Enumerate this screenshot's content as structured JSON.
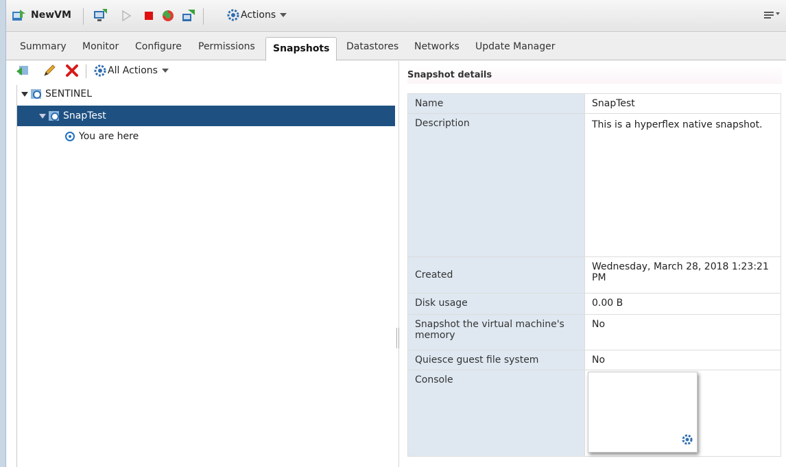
{
  "toolbar": {
    "vm_name": "NewVM",
    "actions_label": "Actions"
  },
  "tabs": [
    {
      "label": "Summary"
    },
    {
      "label": "Monitor"
    },
    {
      "label": "Configure"
    },
    {
      "label": "Permissions"
    },
    {
      "label": "Snapshots"
    },
    {
      "label": "Datastores"
    },
    {
      "label": "Networks"
    },
    {
      "label": "Update Manager"
    }
  ],
  "snapshot_toolbar": {
    "all_actions_label": "All Actions"
  },
  "tree": {
    "root": "SENTINEL",
    "snapshot": "SnapTest",
    "current": "You are here"
  },
  "details": {
    "header": "Snapshot details",
    "rows": [
      {
        "key": "Name",
        "value": "SnapTest"
      },
      {
        "key": "Description",
        "value": "This is a hyperflex native snapshot."
      },
      {
        "key": "Created",
        "value": "Wednesday, March 28, 2018 1:23:21 PM"
      },
      {
        "key": "Disk usage",
        "value": "0.00 B"
      },
      {
        "key": "Snapshot the virtual machine's memory",
        "value": "No"
      },
      {
        "key": "Quiesce guest file system",
        "value": "No"
      },
      {
        "key": "Console",
        "value": ""
      }
    ]
  },
  "colors": {
    "selection": "#1e5181",
    "detail_key_bg": "#dfe8f1",
    "power_off_red": "#e01010"
  }
}
